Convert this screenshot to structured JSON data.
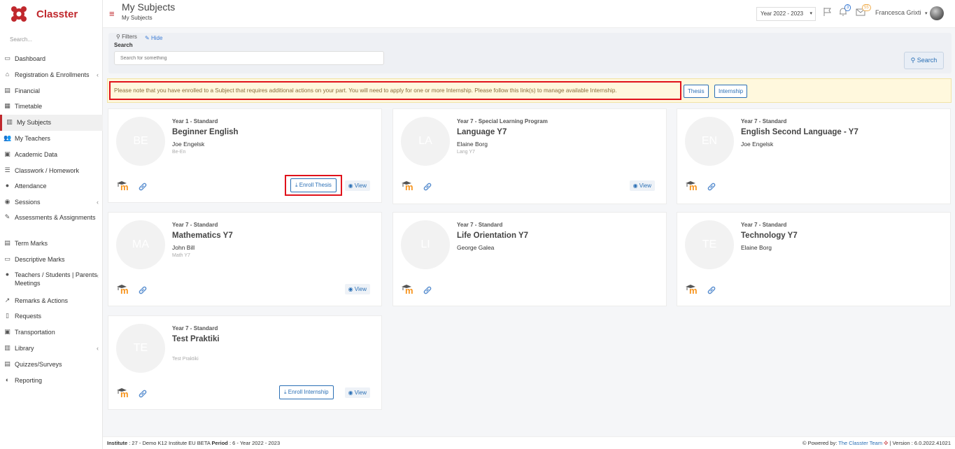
{
  "app": {
    "name": "Classter"
  },
  "sidebar": {
    "search_placeholder": "Search...",
    "items": [
      {
        "label": "Dashboard",
        "icon": "monitor-icon",
        "chevron": false
      },
      {
        "label": "Registration & Enrollments",
        "icon": "institution-icon",
        "chevron": true
      },
      {
        "label": "Financial",
        "icon": "money-icon",
        "chevron": false
      },
      {
        "label": "Timetable",
        "icon": "calendar-icon",
        "chevron": false
      },
      {
        "label": "My Subjects",
        "icon": "books-icon",
        "chevron": false,
        "active": true
      },
      {
        "label": "My Teachers",
        "icon": "users-icon",
        "chevron": false
      },
      {
        "label": "Academic Data",
        "icon": "id-card-icon",
        "chevron": false
      },
      {
        "label": "Classwork / Homework",
        "icon": "list-icon",
        "chevron": false
      },
      {
        "label": "Attendance",
        "icon": "user-check-icon",
        "chevron": false
      },
      {
        "label": "Sessions",
        "icon": "sessions-icon",
        "chevron": true
      },
      {
        "label": "Assessments & Assignments",
        "icon": "edit-icon",
        "chevron": false,
        "tall": true
      },
      {
        "label": "Term Marks",
        "icon": "marks-icon",
        "chevron": false
      },
      {
        "label": "Descriptive Marks",
        "icon": "comment-icon",
        "chevron": false
      },
      {
        "label": "Teachers / Students | Parents Meetings",
        "icon": "meeting-icon",
        "chevron": true,
        "tall": true
      },
      {
        "label": "Remarks & Actions",
        "icon": "remarks-icon",
        "chevron": false
      },
      {
        "label": "Requests",
        "icon": "file-icon",
        "chevron": false
      },
      {
        "label": "Transportation",
        "icon": "bus-icon",
        "chevron": false
      },
      {
        "label": "Library",
        "icon": "library-icon",
        "chevron": true
      },
      {
        "label": "Quizzes/Surveys",
        "icon": "quiz-icon",
        "chevron": false
      },
      {
        "label": "Reporting",
        "icon": "reporting-icon",
        "chevron": false
      }
    ]
  },
  "header": {
    "title": "My Subjects",
    "breadcrumb": "My Subjects",
    "year": "Year 2022 - 2023",
    "notifications_count": "3",
    "messages_count": "55",
    "user_name": "Francesca Grixti"
  },
  "filters": {
    "filters_label": "Filters",
    "hide_label": "Hide",
    "search_label": "Search",
    "search_placeholder": "Search for something",
    "search_button": "Search"
  },
  "alert": {
    "text": "Please note that you have enrolled to a Subject that requires additional actions on your part. You will need to apply for one or more Internship. Please follow this link(s) to manage available Internship.",
    "thesis_button": "Thesis",
    "internship_button": "Internship"
  },
  "subjects": [
    {
      "initials": "BE",
      "level": "Year 1 - Standard",
      "title": "Beginner English",
      "teacher": "Joe Engelsk",
      "code": "Be-En",
      "enroll": "Enroll Thesis",
      "view": "View"
    },
    {
      "initials": "LA",
      "level": "Year 7 - Special Learning Program",
      "title": "Language Y7",
      "teacher": "Elaine Borg",
      "code": "Lang Y7",
      "enroll": "",
      "view": "View"
    },
    {
      "initials": "EN",
      "level": "Year 7 - Standard",
      "title": "English Second Language - Y7",
      "teacher": "Joe Engelsk",
      "code": "",
      "enroll": "",
      "view": ""
    },
    {
      "initials": "MA",
      "level": "Year 7 - Standard",
      "title": "Mathematics Y7",
      "teacher": "John Bill",
      "code": "Math Y7",
      "enroll": "",
      "view": "View"
    },
    {
      "initials": "LI",
      "level": "Year 7 - Standard",
      "title": "Life Orientation Y7",
      "teacher": "George Galea",
      "code": "",
      "enroll": "",
      "view": ""
    },
    {
      "initials": "TE",
      "level": "Year 7 - Standard",
      "title": "Technology Y7",
      "teacher": "Elaine Borg",
      "code": "",
      "enroll": "",
      "view": ""
    },
    {
      "initials": "TE",
      "level": "Year 7 - Standard",
      "title": "Test Praktiki",
      "teacher": "",
      "code": "Test Praktiki",
      "enroll": "Enroll Internship",
      "view": "View"
    }
  ],
  "footer": {
    "institute_label": "Institute",
    "institute_value": ": 27 - Demo K12 Institute EU BETA",
    "period_label": "Period",
    "period_value": ": 6 - Year 2022 - 2023",
    "powered_by": "Powered by:",
    "team": "The Classter Team",
    "version": "| Version : 6.0.2022.41021"
  }
}
